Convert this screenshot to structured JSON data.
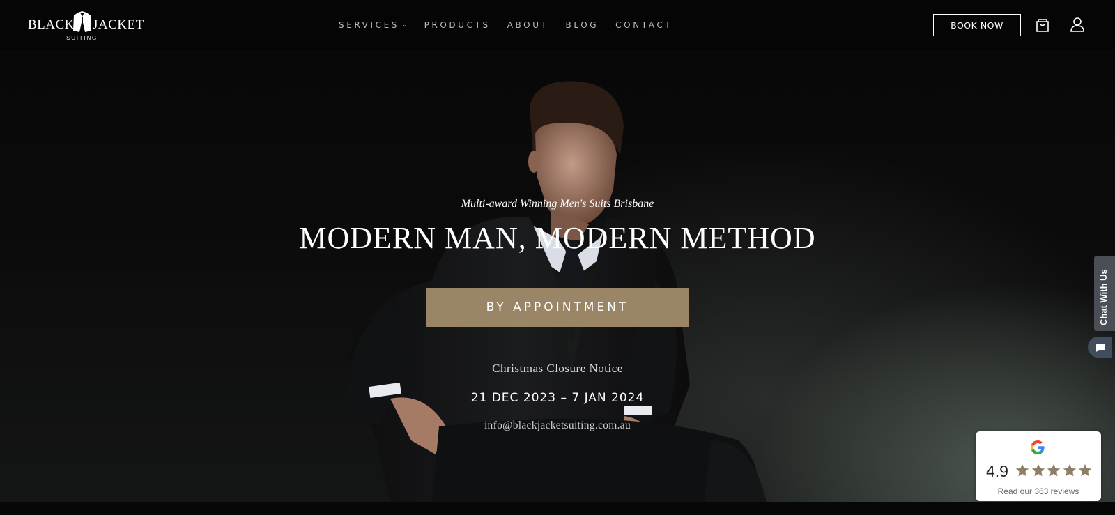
{
  "header": {
    "logo": {
      "word_left": "BLACK",
      "word_right": "JACKET",
      "sub": "SUITING"
    },
    "nav": [
      {
        "label": "SERVICES",
        "has_dropdown": true,
        "chevron": "⌄"
      },
      {
        "label": "PRODUCTS"
      },
      {
        "label": "ABOUT"
      },
      {
        "label": "BLOG"
      },
      {
        "label": "CONTACT"
      }
    ],
    "book_now": "BOOK NOW",
    "icons": {
      "cart": "shopping-bag-icon",
      "user": "user-icon"
    }
  },
  "hero": {
    "subtitle": "Multi-award Winning Men's Suits Brisbane",
    "title": "MODERN MAN, MODERN METHOD",
    "cta": "BY APPOINTMENT",
    "closure_heading": "Christmas Closure Notice",
    "closure_dates": "21 DEC 2023 – 7 JAN 2024",
    "email": "info@blackjacketsuiting.com.au"
  },
  "chat": {
    "label": "Chat With Us",
    "icon": "chat-bubble-icon"
  },
  "reviews": {
    "rating": "4.9",
    "stars": 5,
    "link_text": "Read our 363 reviews",
    "icon": "google-icon"
  },
  "colors": {
    "accent_button": "#9a8566",
    "star": "#8f7d66",
    "chat_tab": "#4a4f55",
    "header_bg": "#050505"
  }
}
